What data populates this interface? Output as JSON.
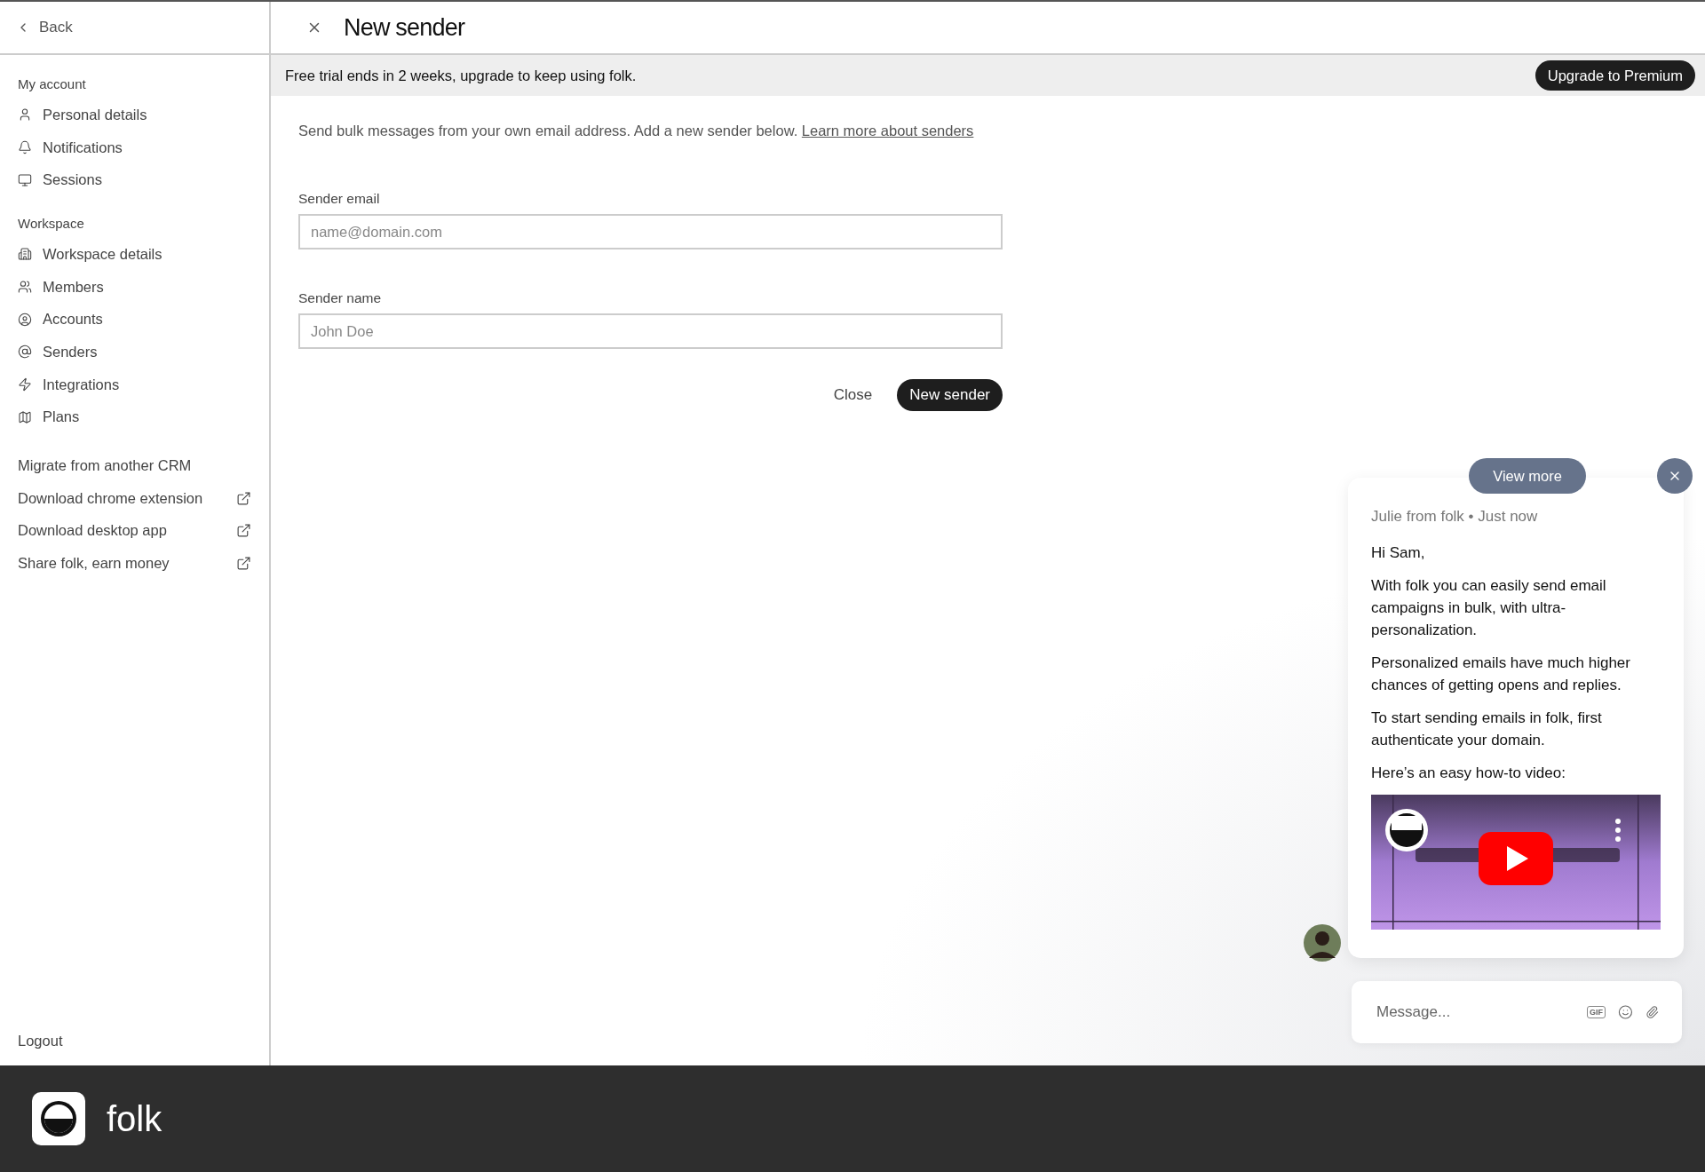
{
  "back": "Back",
  "title": "New sender",
  "sidebar": {
    "sections": [
      {
        "heading": "My account",
        "items": [
          {
            "label": "Personal details"
          },
          {
            "label": "Notifications"
          },
          {
            "label": "Sessions"
          }
        ]
      },
      {
        "heading": "Workspace",
        "items": [
          {
            "label": "Workspace details"
          },
          {
            "label": "Members"
          },
          {
            "label": "Accounts"
          },
          {
            "label": "Senders"
          },
          {
            "label": "Integrations"
          },
          {
            "label": "Plans"
          }
        ]
      }
    ],
    "links": [
      {
        "label": "Migrate from another CRM",
        "external": false
      },
      {
        "label": "Download chrome extension",
        "external": true
      },
      {
        "label": "Download desktop app",
        "external": true
      },
      {
        "label": "Share folk, earn money",
        "external": true
      }
    ],
    "logout": "Logout"
  },
  "banner": {
    "text": "Free trial ends in 2 weeks, upgrade to keep using folk.",
    "button": "Upgrade to Premium"
  },
  "intro": {
    "text": "Send bulk messages from your own email address. Add a new sender below.",
    "link": "Learn more about senders"
  },
  "fields": [
    {
      "label": "Sender email",
      "placeholder": "name@domain.com"
    },
    {
      "label": "Sender name",
      "placeholder": "John Doe"
    }
  ],
  "actions": {
    "cancel": "Close",
    "submit": "New sender"
  },
  "chat": {
    "view_more": "View more",
    "meta": "Julie from folk • Just now",
    "paragraphs": [
      "Hi Sam,",
      "With folk you can easily send email campaigns in bulk, with ultra-personalization.",
      "Personalized emails have much higher chances of getting opens and replies.",
      "To start sending emails in folk, first authenticate your domain.",
      "Here’s an easy how-to video:"
    ],
    "video": {
      "kind": "picture"
    },
    "message_placeholder": "Message...",
    "gif": "GIF"
  },
  "footer": {
    "app_name": "folk"
  }
}
